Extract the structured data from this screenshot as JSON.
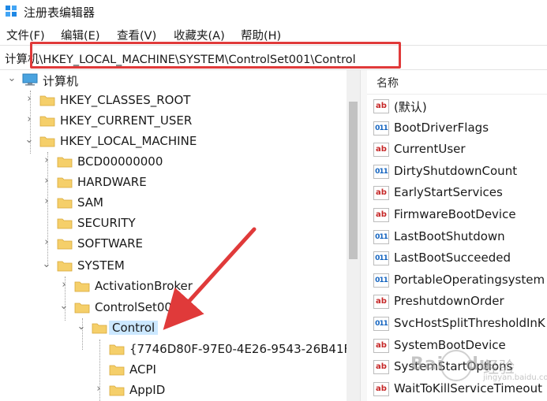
{
  "window": {
    "title": "注册表编辑器"
  },
  "menu": [
    "文件(F)",
    "编辑(E)",
    "查看(V)",
    "收藏夹(A)",
    "帮助(H)"
  ],
  "address": {
    "path": "计算机\\HKEY_LOCAL_MACHINE\\SYSTEM\\ControlSet001\\Control",
    "highlight_color": "#e03a3a"
  },
  "tree": {
    "root": "计算机",
    "items": [
      "HKEY_CLASSES_ROOT",
      "HKEY_CURRENT_USER",
      "HKEY_LOCAL_MACHINE",
      "BCD00000000",
      "HARDWARE",
      "SAM",
      "SECURITY",
      "SOFTWARE",
      "SYSTEM",
      "ActivationBroker",
      "ControlSet001",
      "Control",
      "{7746D80F-97E0-4E26-9543-26B41F",
      "ACPI",
      "AppID"
    ],
    "selected": "Control"
  },
  "values_pane": {
    "column_name": "名称",
    "rows": [
      {
        "icon": "string-value-icon",
        "name": "(默认)"
      },
      {
        "icon": "binary-value-icon",
        "name": "BootDriverFlags"
      },
      {
        "icon": "string-value-icon",
        "name": "CurrentUser"
      },
      {
        "icon": "binary-value-icon",
        "name": "DirtyShutdownCount"
      },
      {
        "icon": "string-value-icon",
        "name": "EarlyStartServices"
      },
      {
        "icon": "string-value-icon",
        "name": "FirmwareBootDevice"
      },
      {
        "icon": "binary-value-icon",
        "name": "LastBootShutdown"
      },
      {
        "icon": "binary-value-icon",
        "name": "LastBootSucceeded"
      },
      {
        "icon": "binary-value-icon",
        "name": "PortableOperatingsystem"
      },
      {
        "icon": "string-value-icon",
        "name": "PreshutdownOrder"
      },
      {
        "icon": "binary-value-icon",
        "name": "SvcHostSplitThresholdInK"
      },
      {
        "icon": "string-value-icon",
        "name": "SystemBootDevice"
      },
      {
        "icon": "string-value-icon",
        "name": "SystemStartOptions"
      },
      {
        "icon": "string-value-icon",
        "name": "WaitToKillServiceTimeout"
      }
    ],
    "string_icon_text": "ab",
    "binary_icon_text": "011"
  },
  "watermark": {
    "brand": "Bai",
    "brand2": "du",
    "text": "经验",
    "sub": "jingyan.baidu.com"
  },
  "colors": {
    "selection": "#cce8ff",
    "folder": "#f5cf6a",
    "arrow": "#e03a3a"
  }
}
